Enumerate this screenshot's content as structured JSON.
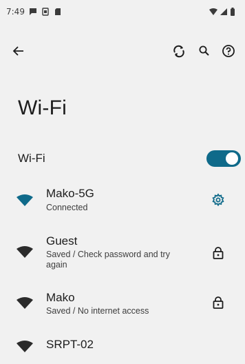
{
  "status_bar": {
    "time": "7:49",
    "icons_left": [
      "chat-notification-icon",
      "screenshot-icon",
      "sd-card-icon"
    ],
    "icons_right": [
      "wifi-signal-icon",
      "cell-signal-icon",
      "battery-icon"
    ]
  },
  "toolbar": {
    "actions": [
      "back-arrow-icon",
      "refresh-icon",
      "search-icon",
      "help-icon"
    ]
  },
  "page": {
    "title": "Wi-Fi"
  },
  "wifi_toggle": {
    "label": "Wi-Fi",
    "state": "on"
  },
  "networks": [
    {
      "name": "Mako-5G",
      "status": "Connected",
      "icon": "wifi-icon",
      "action_icon": "gear-icon",
      "connected": true
    },
    {
      "name": "Guest",
      "status": "Saved / Check password and try again",
      "icon": "wifi-icon",
      "action_icon": "lock-icon",
      "connected": false
    },
    {
      "name": "Mako",
      "status": "Saved / No internet access",
      "icon": "wifi-icon",
      "action_icon": "lock-icon",
      "connected": false
    },
    {
      "name": "SRPT-02",
      "status": "",
      "icon": "wifi-icon",
      "action_icon": "",
      "connected": false
    }
  ],
  "colors": {
    "background": "#f1f1f1",
    "accent": "#0f6a8a",
    "text": "#1c1c1c",
    "icon_inactive": "#2b2b2b"
  }
}
